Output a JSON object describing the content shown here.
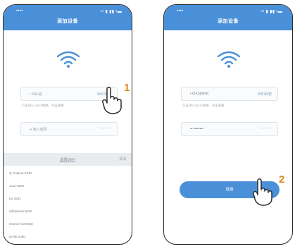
{
  "left_screen": {
    "status_left": "•••• ",
    "status_right": "•• ▮ ▮▮ •▬",
    "title": "添加设备",
    "wifi_field_value": "• WiFi名",
    "wifi_field_link": "WiFi列表",
    "hint": "只支持2.4GHz网络 · 点击查看",
    "password_field": "•• 输入密码",
    "password_toggle": "— —",
    "list_title": "选择WiFi",
    "list_close": "关闭",
    "wifi_list": [
      "Q-Cabinet-2940",
      "Jcan-5806",
      "tar-3651",
      "adhdwerer-5606",
      "Oneseri-03-5950",
      "Dmilk-1080"
    ]
  },
  "right_screen": {
    "status_left": "•••• ",
    "status_right": "•• ▮ ▮▮ •▬",
    "title": "添加设备",
    "wifi_field_value": "• Q-Cabinet",
    "wifi_field_link": "WiFi列表",
    "hint": "只支持2.4GHz网络 · 点击查看",
    "password_field": "•• ••••••••",
    "password_toggle": "— —",
    "connect_label": "连接"
  },
  "steps": {
    "one": "1",
    "two": "2"
  },
  "colors": {
    "header": "#4a90d9",
    "button": "#4a90d9",
    "step_number": "#e4871a"
  }
}
